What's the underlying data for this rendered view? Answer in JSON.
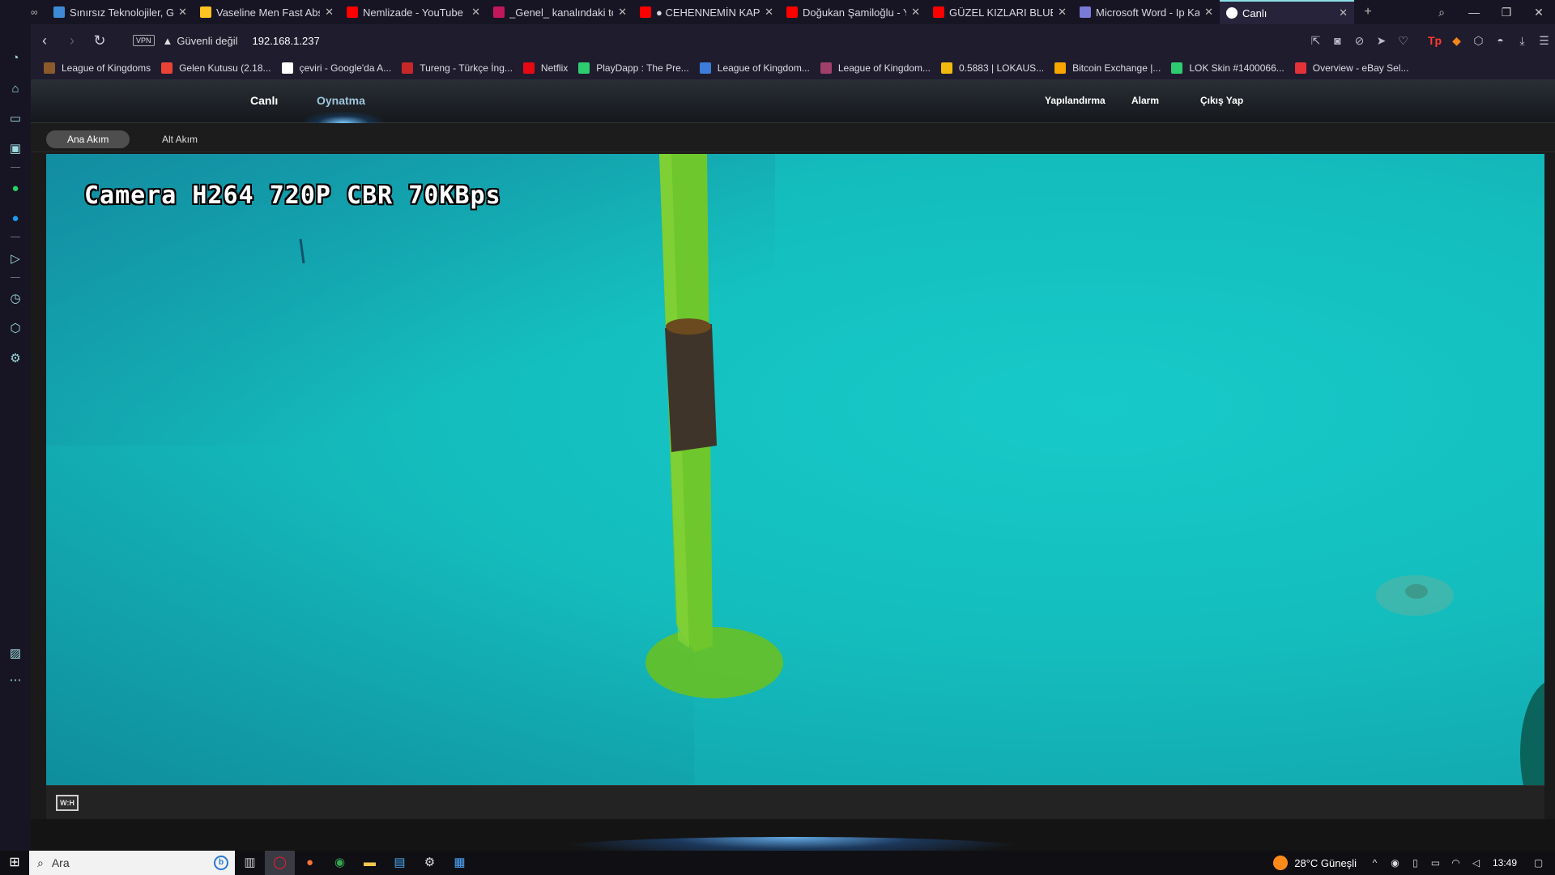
{
  "browser": {
    "tabs": [
      {
        "title": "Sınırsız Teknolojiler, Gü",
        "icon": "triangle-logo-icon",
        "color": "#3d8bd6"
      },
      {
        "title": "Vaseline Men Fast Abso",
        "icon": "walmart-spark-icon",
        "color": "#ffc220"
      },
      {
        "title": "Nemlizade - YouTube",
        "icon": "youtube-icon",
        "color": "#ff0000"
      },
      {
        "title": "_Genel_ kanalındaki top",
        "icon": "play-arrow-icon",
        "color": "#c2185b"
      },
      {
        "title": "● CEHENNEMİN KAPI",
        "icon": "youtube-icon",
        "color": "#ff0000"
      },
      {
        "title": "Doğukan Şamiloğlu - Yo",
        "icon": "youtube-icon",
        "color": "#ff0000"
      },
      {
        "title": "GÜZEL KIZLARI BLUETO",
        "icon": "youtube-icon",
        "color": "#ff0000"
      },
      {
        "title": "Microsoft Word - Ip Kar",
        "icon": "document-icon",
        "color": "#7a7ad8"
      },
      {
        "title": "Canlı",
        "icon": "globe-icon",
        "color": "#ffffff",
        "active": true
      }
    ],
    "security_label": "Güvenli değil",
    "vpn_label": "VPN",
    "url": "192.168.1.237",
    "bookmarks": [
      {
        "label": "League of Kingdoms",
        "color": "#8b5a2b"
      },
      {
        "label": "Gelen Kutusu (2.18...",
        "color": "#ea4335"
      },
      {
        "label": "çeviri - Google'da A...",
        "color": "#ffffff"
      },
      {
        "label": "Tureng - Türkçe İng...",
        "color": "#c62828"
      },
      {
        "label": "Netflix",
        "color": "#e50914"
      },
      {
        "label": "PlayDapp : The Pre...",
        "color": "#2ecc71"
      },
      {
        "label": "League of Kingdom...",
        "color": "#3b7dd8"
      },
      {
        "label": "League of Kingdom...",
        "color": "#a0406a"
      },
      {
        "label": "0.5883 | LOKAUS...",
        "color": "#f0b90b"
      },
      {
        "label": "Bitcoin Exchange |...",
        "color": "#f7a600"
      },
      {
        "label": "LOK Skin #1400066...",
        "color": "#2ecc71"
      },
      {
        "label": "Overview - eBay Sel...",
        "color": "#e53238"
      }
    ]
  },
  "camera_ui": {
    "nav": {
      "live": "Canlı",
      "playback": "Oynatma",
      "config": "Yapılandırma",
      "alarm": "Alarm",
      "logout": "Çıkış Yap"
    },
    "streams": {
      "main": "Ana Akım",
      "sub": "Alt Akım"
    },
    "video_overlay": "Camera H264 720P CBR 70KBps",
    "control_button": "W:H"
  },
  "taskbar": {
    "search_placeholder": "Ara",
    "weather": "28°C  Güneşli",
    "time": "13:49"
  },
  "colors": {
    "accent": "#8be0e8",
    "video_water": "#15c2c3",
    "pole": "#6fc62b"
  }
}
